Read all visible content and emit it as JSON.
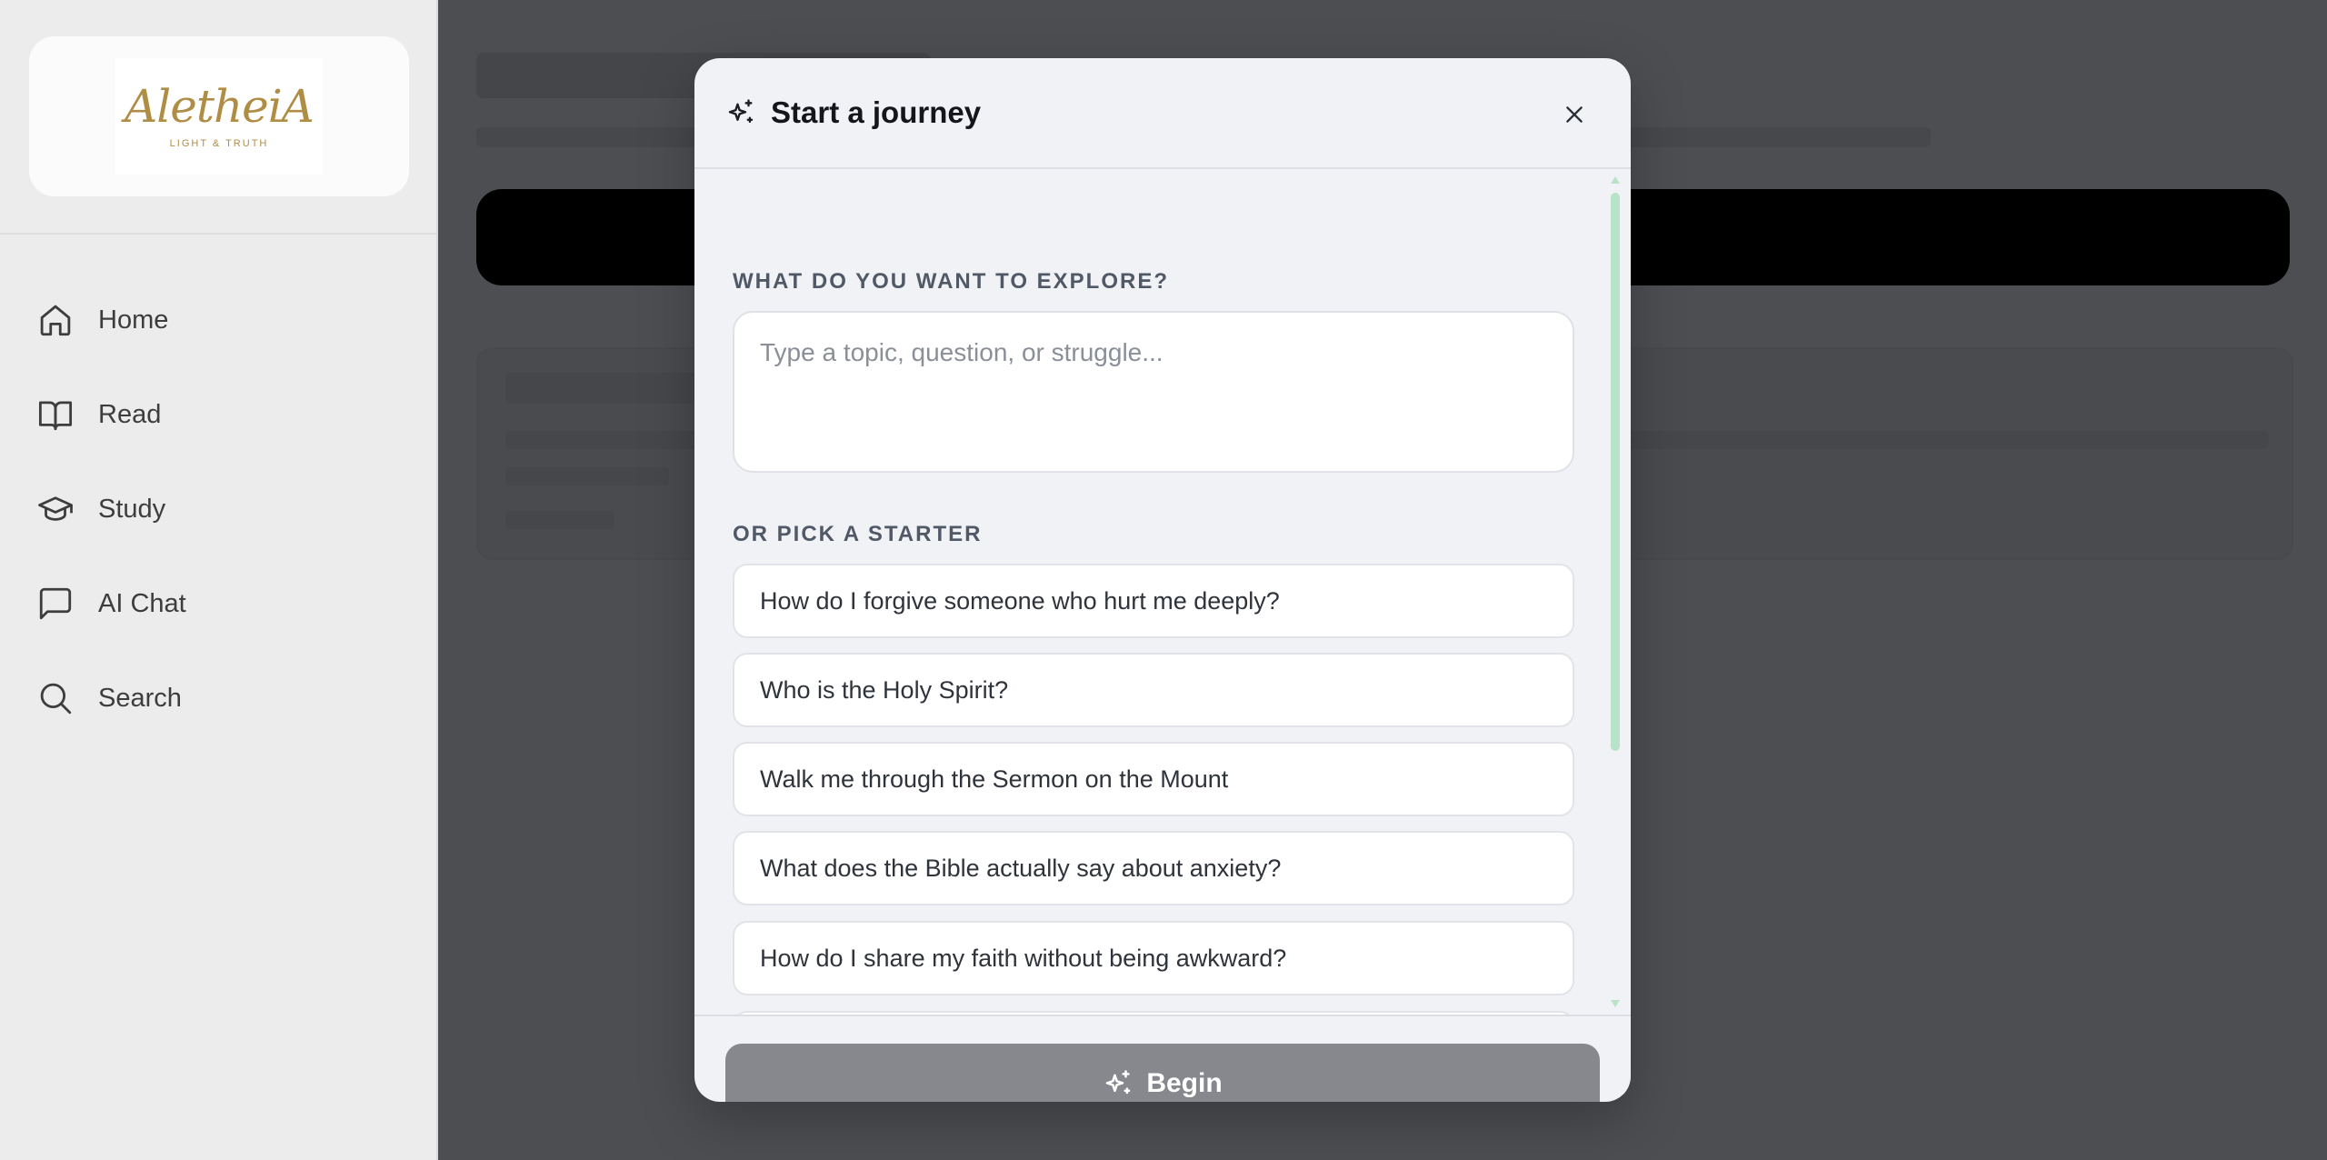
{
  "brand": {
    "logo_word": "AletheiA",
    "logo_tagline": "LIGHT & TRUTH"
  },
  "sidebar": {
    "items": [
      {
        "label": "Home",
        "icon": "home-icon"
      },
      {
        "label": "Read",
        "icon": "book-icon"
      },
      {
        "label": "Study",
        "icon": "graduation-cap-icon"
      },
      {
        "label": "AI Chat",
        "icon": "chat-bubble-icon"
      },
      {
        "label": "Search",
        "icon": "search-icon"
      }
    ]
  },
  "modal": {
    "title": "Start a journey",
    "explore_label": "WHAT DO YOU WANT TO EXPLORE?",
    "topic_value": "",
    "topic_placeholder": "Type a topic, question, or struggle...",
    "starter_label": "OR PICK A STARTER",
    "starters": [
      "How do I forgive someone who hurt me deeply?",
      "Who is the Holy Spirit?",
      "Walk me through the Sermon on the Mount",
      "What does the Bible actually say about anxiety?",
      "How do I share my faith without being awkward?"
    ],
    "begin_label": "Begin"
  },
  "colors": {
    "brand_gold": "#b08d45",
    "overlay": "#4d4e52",
    "begin_disabled": "#86888d",
    "scrollbar": "#b9e3c8"
  }
}
